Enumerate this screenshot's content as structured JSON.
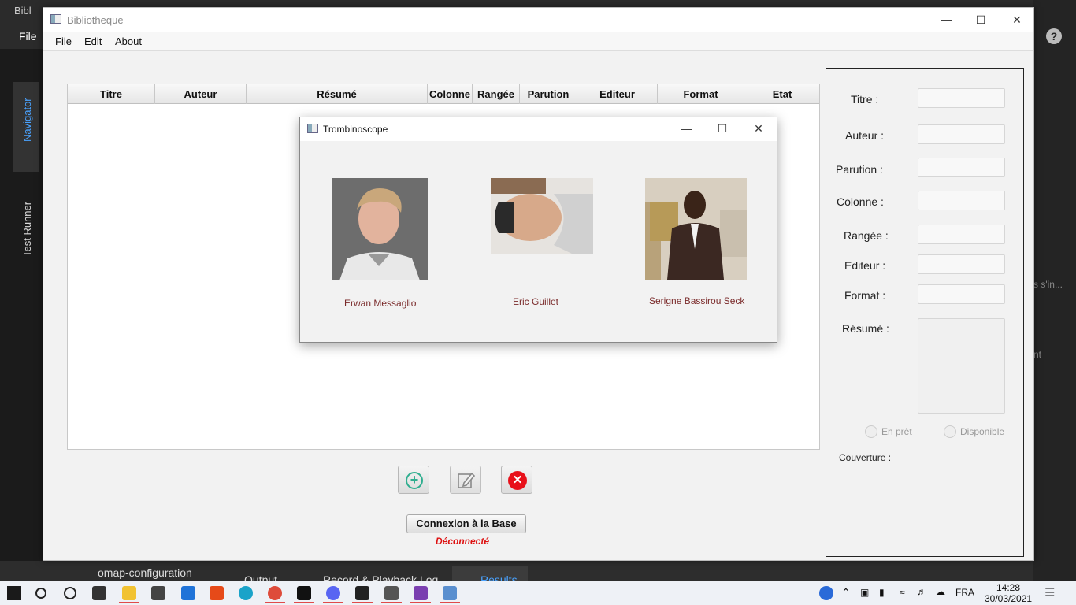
{
  "ide": {
    "title": "Bibl",
    "file_menu": "File",
    "navigator_label": "Navigator",
    "test_runner_label": "Test Runner",
    "right_text_1": "s s'in...",
    "right_text_2": "nt",
    "bottom_tabs": [
      "omap-configuration",
      "Output",
      "Record & Playback Log",
      "Results"
    ]
  },
  "window": {
    "title": "Bibliotheque",
    "menu": [
      "File",
      "Edit",
      "About"
    ]
  },
  "table": {
    "columns": [
      "Titre",
      "Auteur",
      "Résumé",
      "Colonne",
      "Rangée",
      "Parution",
      "Editeur",
      "Format",
      "Etat"
    ],
    "rows": []
  },
  "actions": {
    "add_icon": "plus-circle-icon",
    "edit_icon": "edit-icon",
    "delete_icon": "delete-icon",
    "connect_label": "Connexion à la Base",
    "status": "Déconnecté",
    "status_color": "#dd1111"
  },
  "form": {
    "titre_label": "Titre :",
    "auteur_label": "Auteur :",
    "parution_label": "Parution :",
    "colonne_label": "Colonne :",
    "rangee_label": "Rangée :",
    "editeur_label": "Editeur :",
    "format_label": "Format :",
    "resume_label": "Résumé :",
    "titre_value": "",
    "auteur_value": "",
    "parution_value": "",
    "colonne_value": "",
    "rangee_value": "",
    "editeur_value": "",
    "format_value": "",
    "resume_value": "",
    "radio_en_pret": "En prêt",
    "radio_disponible": "Disponible",
    "couverture_label": "Couverture :"
  },
  "dialog": {
    "title": "Trombinoscope",
    "people": [
      {
        "name": "Erwan Messaglio"
      },
      {
        "name": "Eric Guillet"
      },
      {
        "name": "Serigne Bassirou Seck"
      }
    ]
  },
  "tray": {
    "language": "FRA",
    "time": "14:28",
    "date": "30/03/2021"
  }
}
